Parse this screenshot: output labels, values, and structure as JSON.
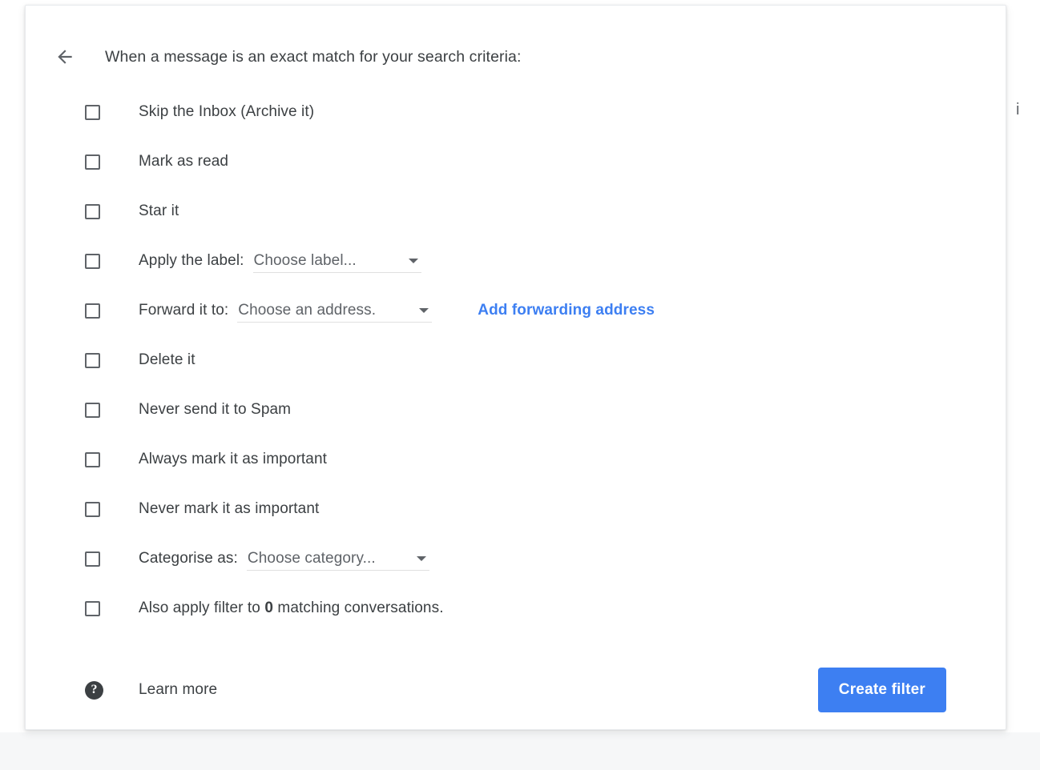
{
  "header": {
    "back_icon": "back-arrow-icon",
    "title": "When a message is an exact match for your search criteria:"
  },
  "options": [
    {
      "id": "skip-inbox",
      "label": "Skip the Inbox (Archive it)",
      "checked": false,
      "type": "plain"
    },
    {
      "id": "mark-as-read",
      "label": "Mark as read",
      "checked": false,
      "type": "plain"
    },
    {
      "id": "star-it",
      "label": "Star it",
      "checked": false,
      "type": "plain"
    },
    {
      "id": "apply-label",
      "label": "Apply the label:",
      "checked": false,
      "type": "select",
      "select_value": "Choose label..."
    },
    {
      "id": "forward-to",
      "label": "Forward it to:",
      "checked": false,
      "type": "select-link",
      "select_value": "Choose an address.",
      "link_label": "Add forwarding address"
    },
    {
      "id": "delete-it",
      "label": "Delete it",
      "checked": false,
      "type": "plain"
    },
    {
      "id": "never-spam",
      "label": "Never send it to Spam",
      "checked": false,
      "type": "plain"
    },
    {
      "id": "always-important",
      "label": "Always mark it as important",
      "checked": false,
      "type": "plain"
    },
    {
      "id": "never-important",
      "label": "Never mark it as important",
      "checked": false,
      "type": "plain"
    },
    {
      "id": "categorise-as",
      "label": "Categorise as:",
      "checked": false,
      "type": "select",
      "select_value": "Choose category..."
    },
    {
      "id": "also-apply",
      "label_before": "Also apply filter to ",
      "label_count": "0",
      "label_after": " matching conversations.",
      "checked": false,
      "type": "rich"
    }
  ],
  "footer": {
    "help_icon": "help-circle-icon",
    "learn_more_label": "Learn more",
    "create_filter_label": "Create filter"
  },
  "edge": {
    "clipped_text": "i"
  },
  "colors": {
    "accent_blue": "#3d7ff2",
    "text_primary": "#3c4043",
    "text_secondary": "#5f6368",
    "card_background": "#ffffff",
    "page_background": "#f6f7f8"
  }
}
